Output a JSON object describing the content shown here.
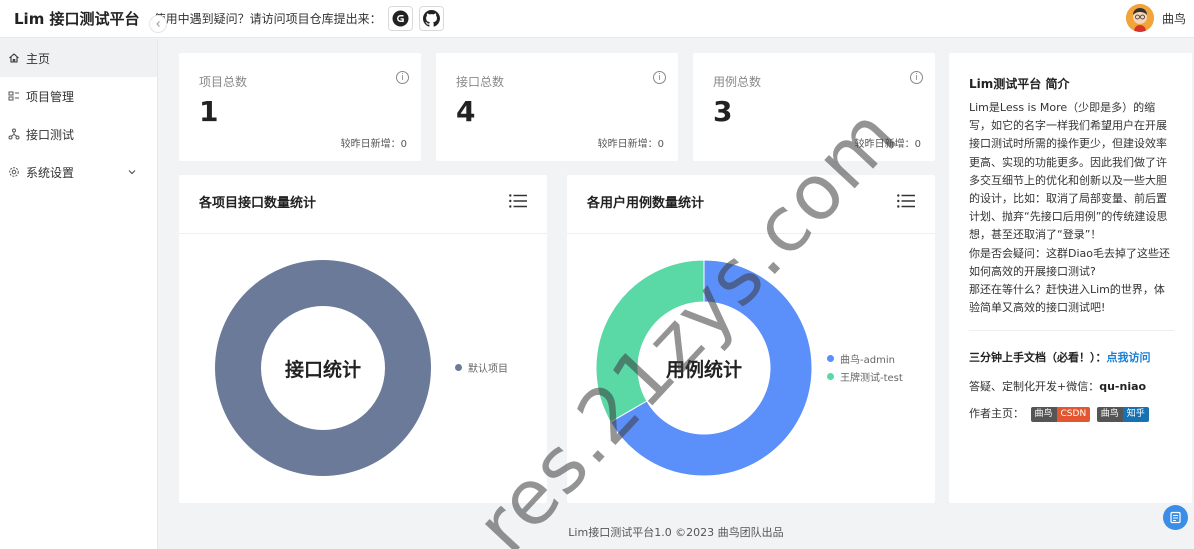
{
  "header": {
    "brand": "Lim 接口测试平台",
    "notice": "使用中遇到疑问？请访问项目仓库提出来：",
    "user_name": "曲鸟"
  },
  "sidebar": {
    "items": [
      {
        "label": "主页",
        "icon": "home-icon"
      },
      {
        "label": "项目管理",
        "icon": "project-icon"
      },
      {
        "label": "接口测试",
        "icon": "api-test-icon"
      },
      {
        "label": "系统设置",
        "icon": "gear-icon"
      }
    ]
  },
  "stats": [
    {
      "label": "项目总数",
      "value": "1",
      "sub": "较昨日新增：0"
    },
    {
      "label": "接口总数",
      "value": "4",
      "sub": "较昨日新增：0"
    },
    {
      "label": "用例总数",
      "value": "3",
      "sub": "较昨日新增：0"
    }
  ],
  "charts": {
    "left": {
      "title": "各项目接口数量统计",
      "center": "接口统计"
    },
    "right": {
      "title": "各用户用例数量统计",
      "center": "用例统计"
    }
  },
  "chart_data": [
    {
      "type": "pie",
      "title": "各项目接口数量统计",
      "categories": [
        "默认项目"
      ],
      "values": [
        4
      ],
      "colors": [
        "#6b7a99"
      ]
    },
    {
      "type": "pie",
      "title": "各用户用例数量统计",
      "categories": [
        "曲鸟-admin",
        "王牌测试-test"
      ],
      "values": [
        2,
        1
      ],
      "colors": [
        "#5b8ff9",
        "#5ad8a6"
      ]
    }
  ],
  "intro": {
    "title": "Lim测试平台 简介",
    "paragraphs": [
      "Lim是Less is More（少即是多）的缩写，如它的名字一样我们希望用户在开展接口测试时所需的操作更少，但建设效率更高、实现的功能更多。因此我们做了许多交互细节上的优化和创新以及一些大胆的设计，比如：取消了局部变量、前后置计划、抛弃“先接口后用例”的传统建设思想，甚至还取消了“登录”！",
      "你是否会疑问：这群Diao毛去掉了这些还如何高效的开展接口测试?",
      "那还在等什么？赶快进入Lim的世界，体验简单又高效的接口测试吧!"
    ],
    "docs_label": "三分钟上手文档（必看！）：",
    "docs_link": "点我访问",
    "contact_label": "答疑、定制化开发+微信：",
    "contact_value": "qu-niao",
    "author_label": "作者主页：",
    "badge1_left": "曲鸟",
    "badge1_right": "CSDN",
    "badge2_left": "曲鸟",
    "badge2_right": "知乎"
  },
  "footer": "Lim接口测试平台1.0 ©2023 曲鸟团队出品",
  "watermark": "res.21zys.com",
  "colors": {
    "accent": "#1a7fd4",
    "csdn": "#e3562f",
    "zhihu": "#1772b3"
  }
}
